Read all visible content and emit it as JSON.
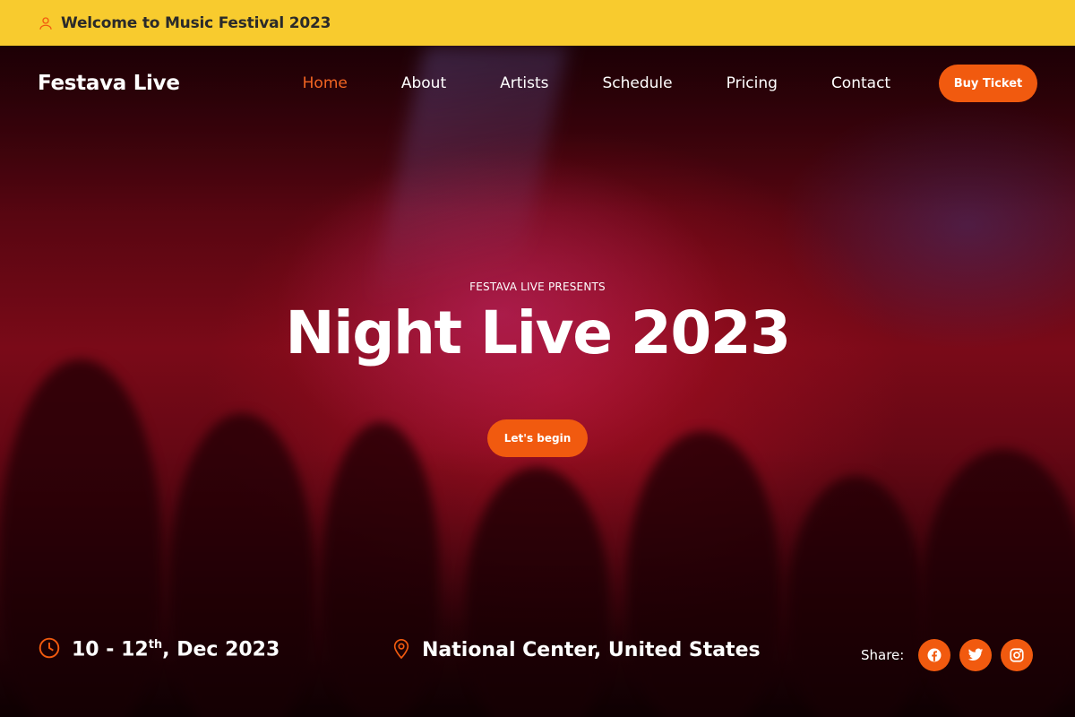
{
  "topbar": {
    "welcome": "Welcome to Music Festival 2023"
  },
  "nav": {
    "brand": "Festava Live",
    "items": [
      {
        "label": "Home",
        "active": true
      },
      {
        "label": "About"
      },
      {
        "label": "Artists"
      },
      {
        "label": "Schedule"
      },
      {
        "label": "Pricing"
      },
      {
        "label": "Contact"
      }
    ],
    "buy_label": "Buy Ticket"
  },
  "hero": {
    "presents": "FESTAVA LIVE PRESENTS",
    "title": "Night Live 2023",
    "cta": "Let's begin"
  },
  "event": {
    "date_start": "10 - 12",
    "date_sup": "th",
    "date_end": ", Dec 2023",
    "location": "National Center, United States"
  },
  "share": {
    "label": "Share:",
    "icons": [
      "facebook-icon",
      "twitter-icon",
      "instagram-icon"
    ]
  },
  "colors": {
    "accent": "#f15a0f",
    "topbar": "#f8cb2e"
  }
}
